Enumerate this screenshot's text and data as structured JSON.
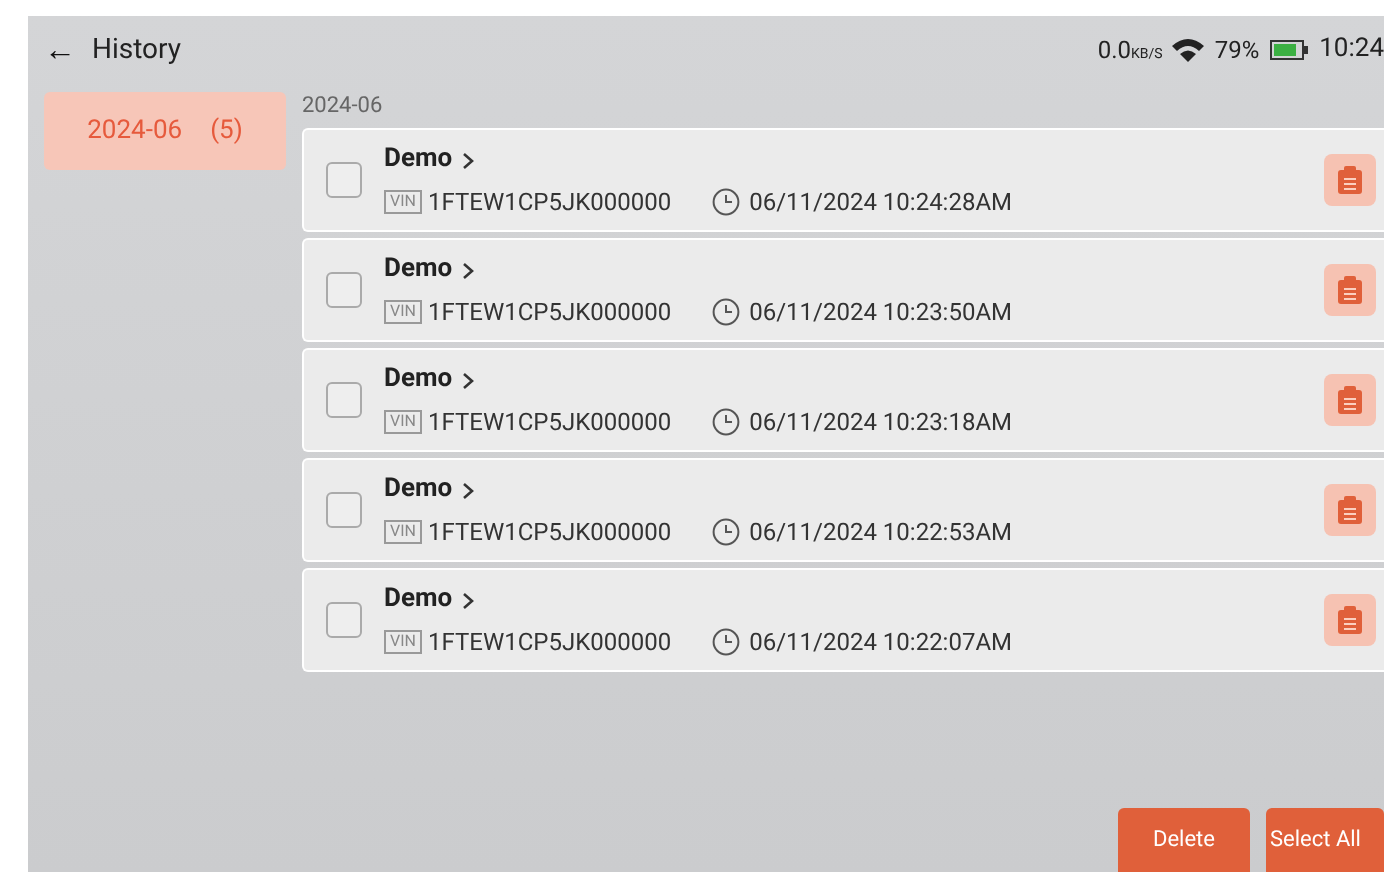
{
  "header": {
    "back": "←",
    "title": "History"
  },
  "status_bar": {
    "speed": "0.0",
    "speed_unit": "KB/S",
    "battery": "79%",
    "time": "10:24"
  },
  "sidebar": {
    "items": [
      {
        "label": "2024-06",
        "count": "(5)",
        "selected": true
      }
    ]
  },
  "section": {
    "label": "2024-06"
  },
  "records": [
    {
      "name": "Demo",
      "vin_tag": "VIN",
      "vin": "1FTEW1CP5JK000000",
      "date": "06/11/2024 10:24:28AM",
      "checked": false
    },
    {
      "name": "Demo",
      "vin_tag": "VIN",
      "vin": "1FTEW1CP5JK000000",
      "date": "06/11/2024 10:23:50AM",
      "checked": false
    },
    {
      "name": "Demo",
      "vin_tag": "VIN",
      "vin": "1FTEW1CP5JK000000",
      "date": "06/11/2024 10:23:18AM",
      "checked": false
    },
    {
      "name": "Demo",
      "vin_tag": "VIN",
      "vin": "1FTEW1CP5JK000000",
      "date": "06/11/2024 10:22:53AM",
      "checked": false
    },
    {
      "name": "Demo",
      "vin_tag": "VIN",
      "vin": "1FTEW1CP5JK000000",
      "date": "06/11/2024 10:22:07AM",
      "checked": false
    }
  ],
  "buttons": [
    "Delete",
    "Select All"
  ]
}
